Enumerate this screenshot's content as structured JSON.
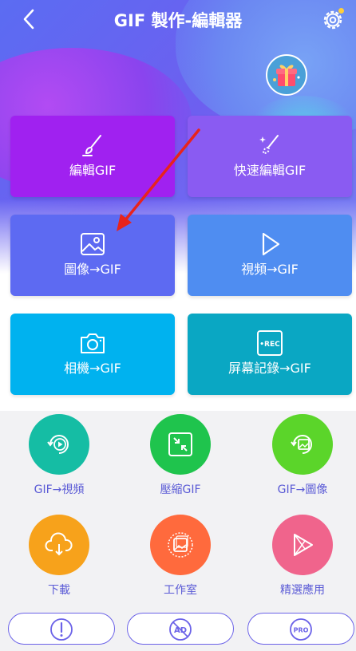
{
  "header": {
    "title": "GIF 製作-編輯器"
  },
  "cards": [
    {
      "label": "編輯GIF",
      "icon": "brush-icon",
      "color": "#a021f0"
    },
    {
      "label": "快速編輯GIF",
      "icon": "magic-brush-icon",
      "color": "#8a5bf2"
    },
    {
      "label": "圖像→GIF",
      "icon": "image-icon",
      "color": "#5d6af2"
    },
    {
      "label": "視頻→GIF",
      "icon": "play-icon",
      "color": "#4f8df1"
    },
    {
      "label": "相機→GIF",
      "icon": "camera-icon",
      "color": "#00b2ef"
    },
    {
      "label": "屏幕記錄→GIF",
      "icon": "rec-icon",
      "color": "#0aa7c3"
    }
  ],
  "rec_badge": "•REC",
  "tools": [
    {
      "label": "GIF→視頻",
      "icon": "gif-to-video-icon",
      "color": "#15bda4"
    },
    {
      "label": "壓縮GIF",
      "icon": "compress-icon",
      "color": "#1fc44d"
    },
    {
      "label": "GIF→圖像",
      "icon": "gif-to-image-icon",
      "color": "#5bd52a"
    },
    {
      "label": "下載",
      "icon": "download-cloud-icon",
      "color": "#f7a21b"
    },
    {
      "label": "工作室",
      "icon": "studio-icon",
      "color": "#ff6a3d"
    },
    {
      "label": "精選應用",
      "icon": "play-store-icon",
      "color": "#f0648c"
    }
  ],
  "bottom_bar": {
    "feedback_icon": "exclamation-icon",
    "ad_label": "AD",
    "pro_label": "PRO"
  },
  "annotation": {
    "color": "#e8231c"
  }
}
